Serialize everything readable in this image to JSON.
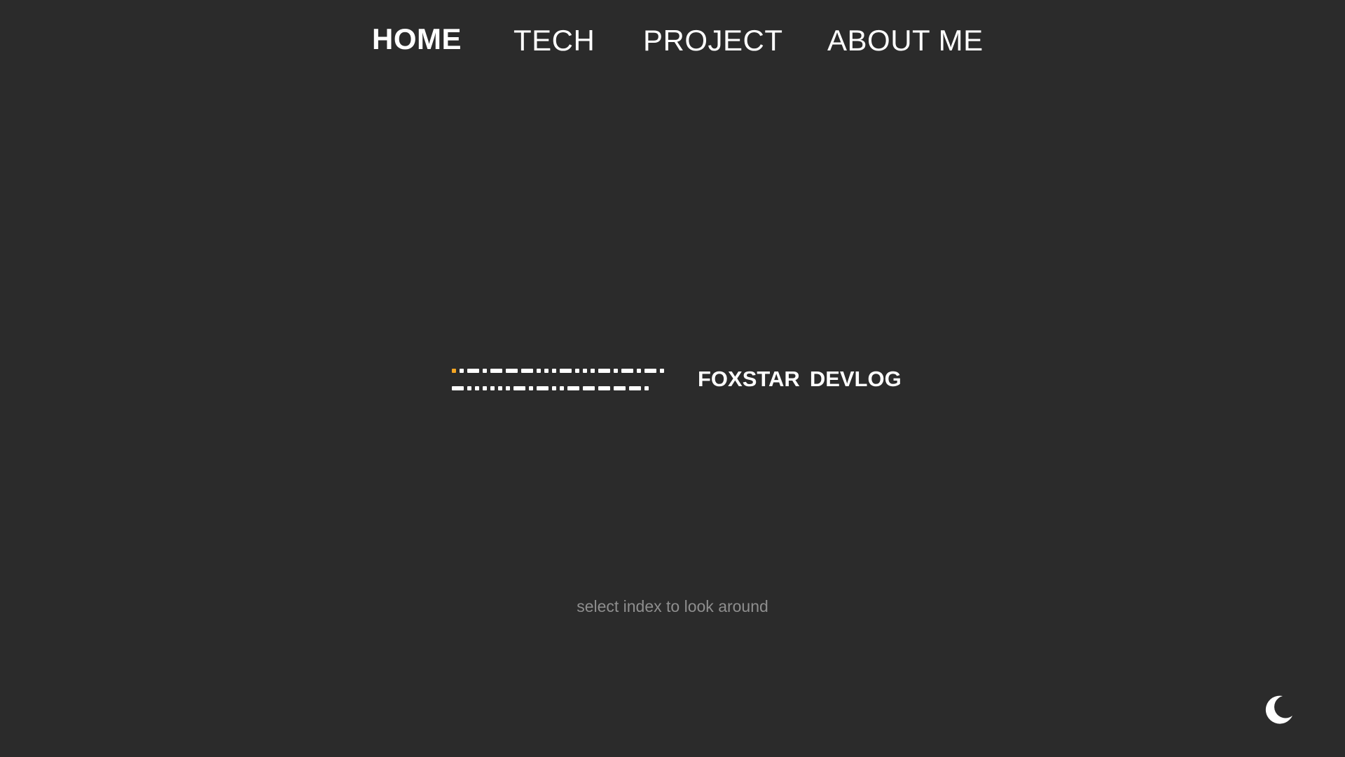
{
  "nav": {
    "items": [
      {
        "label": "HOME",
        "active": true
      },
      {
        "label": "TECH",
        "active": false
      },
      {
        "label": "PROJECT",
        "active": false
      },
      {
        "label": "ABOUT ME",
        "active": false
      }
    ]
  },
  "hero": {
    "brand_word_1": "FOXSTAR",
    "brand_word_2": "DEVLOG",
    "morse_lines": [
      [
        ".",
        ".",
        "-",
        ".",
        "-",
        "-",
        "-",
        ".",
        ".",
        ".",
        "-",
        ".",
        ".",
        ".",
        "-",
        ".",
        "-",
        ".",
        "-",
        "."
      ],
      [
        "-",
        ".",
        ".",
        ".",
        ".",
        ".",
        ".",
        "-",
        ".",
        "-",
        ".",
        ".",
        "-",
        "-",
        "-",
        "-",
        "-",
        "."
      ]
    ],
    "morse_highlight_color": "#f5a623",
    "morse_color": "#ffffff"
  },
  "hint": "select index to look around",
  "theme_toggle": {
    "icon": "moon-icon"
  }
}
